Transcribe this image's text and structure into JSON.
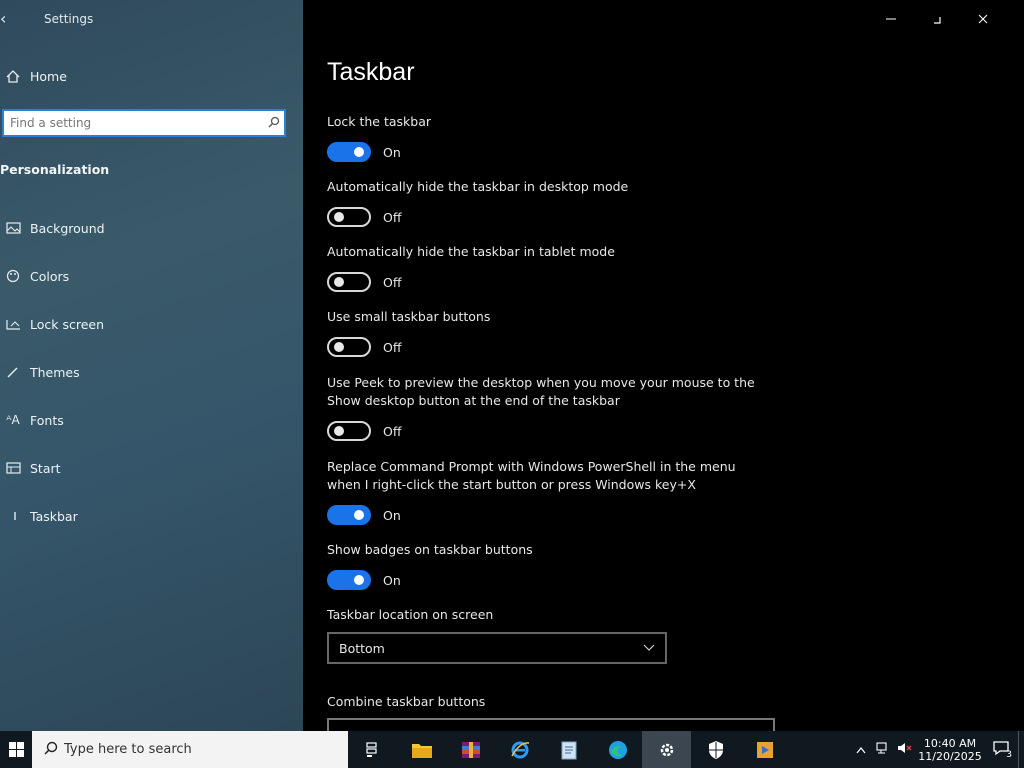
{
  "window": {
    "title": "Settings"
  },
  "sidebar": {
    "home_label": "Home",
    "search_placeholder": "Find a setting",
    "section_heading": "Personalization",
    "items": [
      {
        "label": "Background",
        "icon": "picture-icon"
      },
      {
        "label": "Colors",
        "icon": "palette-icon"
      },
      {
        "label": "Lock screen",
        "icon": "lock-screen-icon"
      },
      {
        "label": "Themes",
        "icon": "brush-icon"
      },
      {
        "label": "Fonts",
        "icon": "fonts-icon"
      },
      {
        "label": "Start",
        "icon": "start-icon"
      },
      {
        "label": "Taskbar",
        "icon": "taskbar-icon"
      }
    ]
  },
  "main": {
    "title": "Taskbar",
    "settings": [
      {
        "label": "Lock the taskbar",
        "state": "On",
        "on": true
      },
      {
        "label": "Automatically hide the taskbar in desktop mode",
        "state": "Off",
        "on": false
      },
      {
        "label": "Automatically hide the taskbar in tablet mode",
        "state": "Off",
        "on": false
      },
      {
        "label": "Use small taskbar buttons",
        "state": "Off",
        "on": false
      },
      {
        "label": "Use Peek to preview the desktop when you move your mouse to the Show desktop button at the end of the taskbar",
        "state": "Off",
        "on": false
      },
      {
        "label": "Replace Command Prompt with Windows PowerShell in the menu when I right-click the start button or press Windows key+X",
        "state": "On",
        "on": true
      },
      {
        "label": "Show badges on taskbar buttons",
        "state": "On",
        "on": true
      }
    ],
    "location_label": "Taskbar location on screen",
    "location_value": "Bottom",
    "combine_label": "Combine taskbar buttons"
  },
  "taskbar": {
    "search_placeholder": "Type here to search",
    "apps": [
      "task-view-icon",
      "file-explorer-icon",
      "winrar-icon",
      "internet-explorer-icon",
      "notepad-icon",
      "edge-icon",
      "settings-icon",
      "security-icon",
      "media-player-icon"
    ],
    "clock_time": "10:40 AM",
    "clock_date": "11/20/2025",
    "notification_count": "3"
  },
  "colors": {
    "accent": "#1a73e8",
    "sidebar": "#35566a",
    "background": "#000000"
  }
}
